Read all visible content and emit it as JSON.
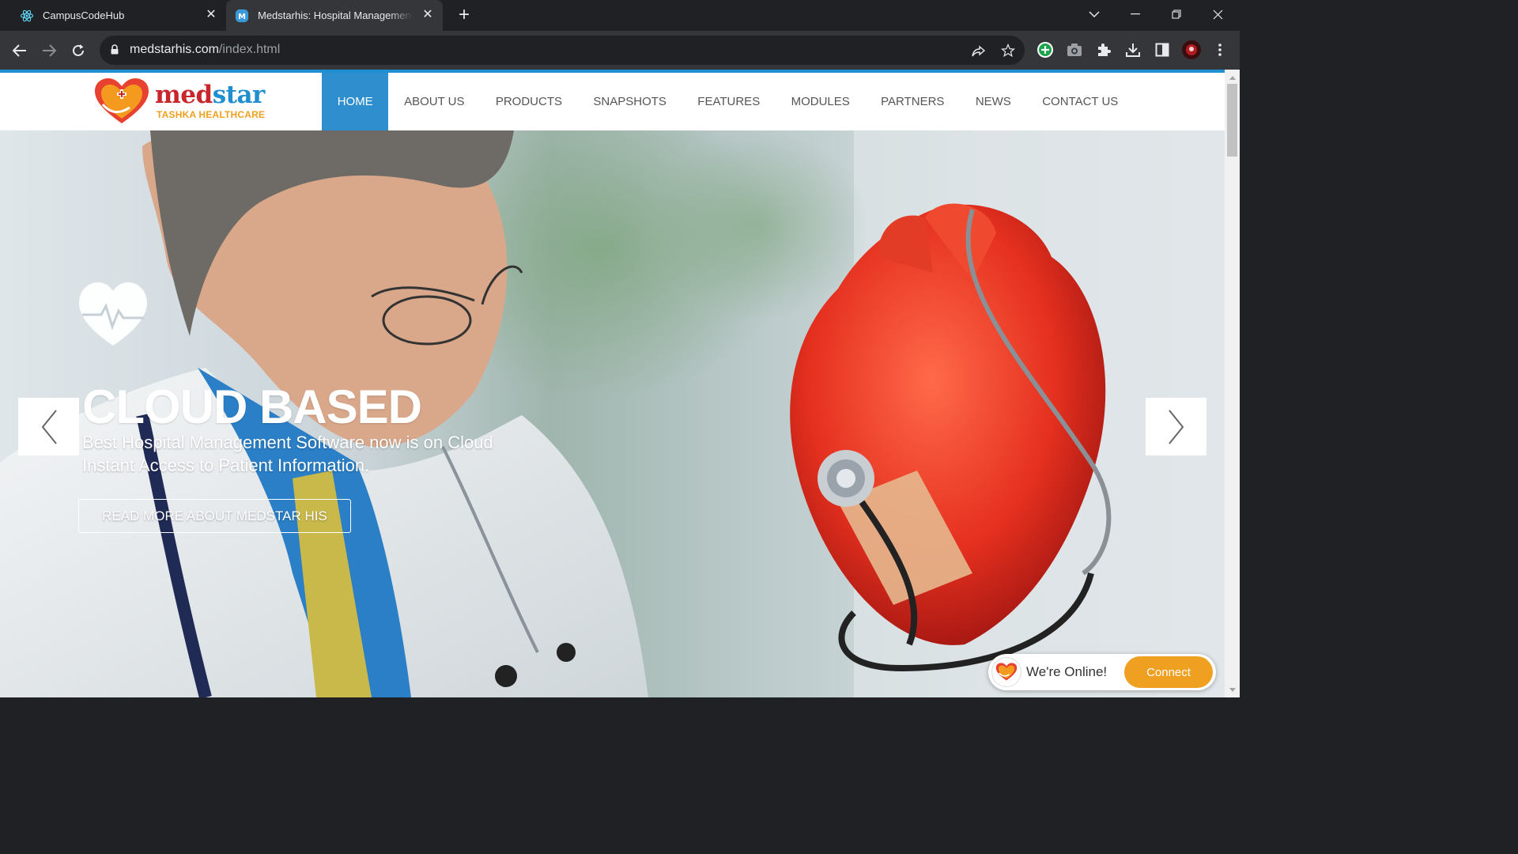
{
  "browser": {
    "tabs": [
      {
        "title": "CampusCodeHub",
        "icon": "react-atom-icon"
      },
      {
        "title": "Medstarhis: Hospital Management Software",
        "icon": "m-favicon-icon",
        "active": true
      }
    ],
    "url_domain": "medstarhis.com",
    "url_path": "/index.html"
  },
  "site": {
    "logo_name_a": "med",
    "logo_name_b": "star",
    "logo_subtitle": "TASHKA HEALTHCARE",
    "nav": [
      {
        "label": "HOME",
        "active": true
      },
      {
        "label": "ABOUT US"
      },
      {
        "label": "PRODUCTS"
      },
      {
        "label": "SNAPSHOTS"
      },
      {
        "label": "FEATURES"
      },
      {
        "label": "MODULES"
      },
      {
        "label": "PARTNERS"
      },
      {
        "label": "NEWS"
      },
      {
        "label": "CONTACT US"
      }
    ],
    "colors": {
      "accent": "#2f8fce",
      "brand_red": "#c8262b",
      "brand_orange": "#f0a020"
    }
  },
  "hero": {
    "title": "CLOUD BASED",
    "line1": "Best Hospital Management Software now is on Cloud",
    "line2": "Instant Access to Patient Information.",
    "cta": "READ MORE ABOUT MEDSTAR HIS"
  },
  "chat": {
    "status": "We're Online!",
    "button": "Connect"
  }
}
